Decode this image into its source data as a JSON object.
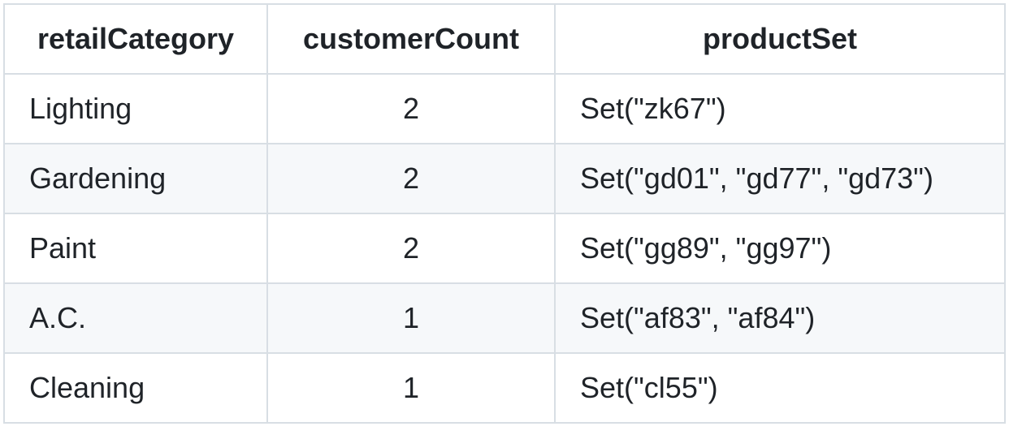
{
  "table": {
    "headers": [
      "retailCategory",
      "customerCount",
      "productSet"
    ],
    "rows": [
      [
        "Lighting",
        "2",
        "Set(\"zk67\")"
      ],
      [
        "Gardening",
        "2",
        "Set(\"gd01\", \"gd77\", \"gd73\")"
      ],
      [
        "Paint",
        "2",
        "Set(\"gg89\", \"gg97\")"
      ],
      [
        "A.C.",
        "1",
        "Set(\"af83\", \"af84\")"
      ],
      [
        "Cleaning",
        "1",
        "Set(\"cl55\")"
      ]
    ]
  }
}
